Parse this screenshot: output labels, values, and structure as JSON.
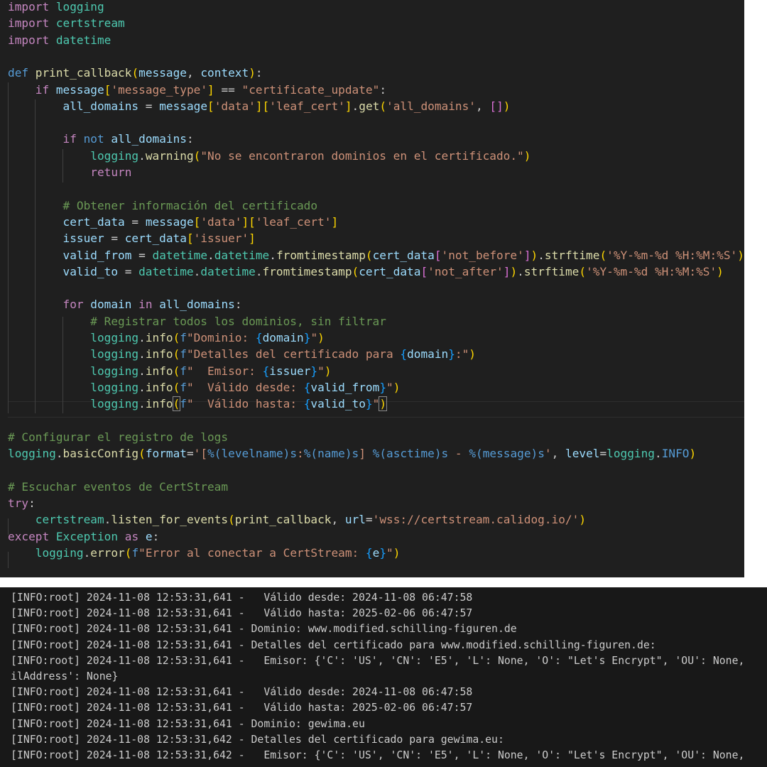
{
  "colors": {
    "editor_bg": "#1f1f1f",
    "terminal_bg": "#181818",
    "keyword": "#c586c0",
    "def_keyword": "#569cd6",
    "function": "#dcdcaa",
    "variable": "#9cdcfe",
    "class": "#4ec9b0",
    "string": "#ce9178",
    "comment": "#6a9955",
    "bracket_level_1": "#ffd700",
    "bracket_level_2": "#da70d6",
    "bracket_level_3": "#179fff"
  },
  "editor": {
    "lines": [
      [
        [
          "kw",
          "import"
        ],
        [
          "pun",
          " "
        ],
        [
          "cls",
          "logging"
        ]
      ],
      [
        [
          "kw",
          "import"
        ],
        [
          "pun",
          " "
        ],
        [
          "cls",
          "certstream"
        ]
      ],
      [
        [
          "kw",
          "import"
        ],
        [
          "pun",
          " "
        ],
        [
          "cls",
          "datetime"
        ]
      ],
      [],
      [
        [
          "def",
          "def"
        ],
        [
          "pun",
          " "
        ],
        [
          "fn",
          "print_callback"
        ],
        [
          "br1",
          "("
        ],
        [
          "var",
          "message"
        ],
        [
          "pun",
          ", "
        ],
        [
          "var",
          "context"
        ],
        [
          "br1",
          ")"
        ],
        [
          "pun",
          ":"
        ]
      ],
      [
        [
          "pun",
          "    "
        ],
        [
          "kw",
          "if"
        ],
        [
          "pun",
          " "
        ],
        [
          "var",
          "message"
        ],
        [
          "br1",
          "["
        ],
        [
          "str",
          "'message_type'"
        ],
        [
          "br1",
          "]"
        ],
        [
          "pun",
          " == "
        ],
        [
          "str",
          "\"certificate_update\""
        ],
        [
          "pun",
          ":"
        ]
      ],
      [
        [
          "pun",
          "        "
        ],
        [
          "var",
          "all_domains"
        ],
        [
          "pun",
          " = "
        ],
        [
          "var",
          "message"
        ],
        [
          "br1",
          "["
        ],
        [
          "str",
          "'data'"
        ],
        [
          "br1",
          "]["
        ],
        [
          "str",
          "'leaf_cert'"
        ],
        [
          "br1",
          "]"
        ],
        [
          "pun",
          "."
        ],
        [
          "fn",
          "get"
        ],
        [
          "br1",
          "("
        ],
        [
          "str",
          "'all_domains'"
        ],
        [
          "pun",
          ", "
        ],
        [
          "br2",
          "[]"
        ],
        [
          "br1",
          ")"
        ]
      ],
      [],
      [
        [
          "pun",
          "        "
        ],
        [
          "kw",
          "if"
        ],
        [
          "pun",
          " "
        ],
        [
          "def",
          "not"
        ],
        [
          "pun",
          " "
        ],
        [
          "var",
          "all_domains"
        ],
        [
          "pun",
          ":"
        ]
      ],
      [
        [
          "pun",
          "            "
        ],
        [
          "cls",
          "logging"
        ],
        [
          "pun",
          "."
        ],
        [
          "fn",
          "warning"
        ],
        [
          "br1",
          "("
        ],
        [
          "str",
          "\"No se encontraron dominios en el certificado.\""
        ],
        [
          "br1",
          ")"
        ]
      ],
      [
        [
          "pun",
          "            "
        ],
        [
          "kw",
          "return"
        ]
      ],
      [],
      [
        [
          "pun",
          "        "
        ],
        [
          "cmt",
          "# Obtener información del certificado"
        ]
      ],
      [
        [
          "pun",
          "        "
        ],
        [
          "var",
          "cert_data"
        ],
        [
          "pun",
          " = "
        ],
        [
          "var",
          "message"
        ],
        [
          "br1",
          "["
        ],
        [
          "str",
          "'data'"
        ],
        [
          "br1",
          "]["
        ],
        [
          "str",
          "'leaf_cert'"
        ],
        [
          "br1",
          "]"
        ]
      ],
      [
        [
          "pun",
          "        "
        ],
        [
          "var",
          "issuer"
        ],
        [
          "pun",
          " = "
        ],
        [
          "var",
          "cert_data"
        ],
        [
          "br1",
          "["
        ],
        [
          "str",
          "'issuer'"
        ],
        [
          "br1",
          "]"
        ]
      ],
      [
        [
          "pun",
          "        "
        ],
        [
          "var",
          "valid_from"
        ],
        [
          "pun",
          " = "
        ],
        [
          "cls",
          "datetime"
        ],
        [
          "pun",
          "."
        ],
        [
          "cls",
          "datetime"
        ],
        [
          "pun",
          "."
        ],
        [
          "fn",
          "fromtimestamp"
        ],
        [
          "br1",
          "("
        ],
        [
          "var",
          "cert_data"
        ],
        [
          "br2",
          "["
        ],
        [
          "str",
          "'not_before'"
        ],
        [
          "br2",
          "]"
        ],
        [
          "br1",
          ")"
        ],
        [
          "pun",
          "."
        ],
        [
          "fn",
          "strftime"
        ],
        [
          "br1",
          "("
        ],
        [
          "str",
          "'%Y-%m-%d %H:%M:%S'"
        ],
        [
          "br1",
          ")"
        ]
      ],
      [
        [
          "pun",
          "        "
        ],
        [
          "var",
          "valid_to"
        ],
        [
          "pun",
          " = "
        ],
        [
          "cls",
          "datetime"
        ],
        [
          "pun",
          "."
        ],
        [
          "cls",
          "datetime"
        ],
        [
          "pun",
          "."
        ],
        [
          "fn",
          "fromtimestamp"
        ],
        [
          "br1",
          "("
        ],
        [
          "var",
          "cert_data"
        ],
        [
          "br2",
          "["
        ],
        [
          "str",
          "'not_after'"
        ],
        [
          "br2",
          "]"
        ],
        [
          "br1",
          ")"
        ],
        [
          "pun",
          "."
        ],
        [
          "fn",
          "strftime"
        ],
        [
          "br1",
          "("
        ],
        [
          "str",
          "'%Y-%m-%d %H:%M:%S'"
        ],
        [
          "br1",
          ")"
        ]
      ],
      [],
      [
        [
          "pun",
          "        "
        ],
        [
          "kw",
          "for"
        ],
        [
          "pun",
          " "
        ],
        [
          "var",
          "domain"
        ],
        [
          "pun",
          " "
        ],
        [
          "kw",
          "in"
        ],
        [
          "pun",
          " "
        ],
        [
          "var",
          "all_domains"
        ],
        [
          "pun",
          ":"
        ]
      ],
      [
        [
          "pun",
          "            "
        ],
        [
          "cmt",
          "# Registrar todos los dominios, sin filtrar"
        ]
      ],
      [
        [
          "pun",
          "            "
        ],
        [
          "cls",
          "logging"
        ],
        [
          "pun",
          "."
        ],
        [
          "fn",
          "info"
        ],
        [
          "br1",
          "("
        ],
        [
          "def",
          "f"
        ],
        [
          "str",
          "\"Dominio: "
        ],
        [
          "br3",
          "{"
        ],
        [
          "var",
          "domain"
        ],
        [
          "br3",
          "}"
        ],
        [
          "str",
          "\""
        ],
        [
          "br1",
          ")"
        ]
      ],
      [
        [
          "pun",
          "            "
        ],
        [
          "cls",
          "logging"
        ],
        [
          "pun",
          "."
        ],
        [
          "fn",
          "info"
        ],
        [
          "br1",
          "("
        ],
        [
          "def",
          "f"
        ],
        [
          "str",
          "\"Detalles del certificado para "
        ],
        [
          "br3",
          "{"
        ],
        [
          "var",
          "domain"
        ],
        [
          "br3",
          "}"
        ],
        [
          "str",
          ":\""
        ],
        [
          "br1",
          ")"
        ]
      ],
      [
        [
          "pun",
          "            "
        ],
        [
          "cls",
          "logging"
        ],
        [
          "pun",
          "."
        ],
        [
          "fn",
          "info"
        ],
        [
          "br1",
          "("
        ],
        [
          "def",
          "f"
        ],
        [
          "str",
          "\"  Emisor: "
        ],
        [
          "br3",
          "{"
        ],
        [
          "var",
          "issuer"
        ],
        [
          "br3",
          "}"
        ],
        [
          "str",
          "\""
        ],
        [
          "br1",
          ")"
        ]
      ],
      [
        [
          "pun",
          "            "
        ],
        [
          "cls",
          "logging"
        ],
        [
          "pun",
          "."
        ],
        [
          "fn",
          "info"
        ],
        [
          "br1",
          "("
        ],
        [
          "def",
          "f"
        ],
        [
          "str",
          "\"  Válido desde: "
        ],
        [
          "br3",
          "{"
        ],
        [
          "var",
          "valid_from"
        ],
        [
          "br3",
          "}"
        ],
        [
          "str",
          "\""
        ],
        [
          "br1",
          ")"
        ]
      ],
      [
        [
          "pun",
          "            "
        ],
        [
          "cls",
          "logging"
        ],
        [
          "pun",
          "."
        ],
        [
          "fn",
          "info"
        ],
        [
          "br1m",
          "("
        ],
        [
          "def",
          "f"
        ],
        [
          "str",
          "\"  Válido hasta: "
        ],
        [
          "br3",
          "{"
        ],
        [
          "var",
          "valid_to"
        ],
        [
          "br3",
          "}"
        ],
        [
          "str",
          "\""
        ],
        [
          "br1m",
          ")"
        ]
      ],
      [],
      [
        [
          "cmt",
          "# Configurar el registro de logs"
        ]
      ],
      [
        [
          "cls",
          "logging"
        ],
        [
          "pun",
          "."
        ],
        [
          "fn",
          "basicConfig"
        ],
        [
          "br1",
          "("
        ],
        [
          "var",
          "format"
        ],
        [
          "pun",
          "="
        ],
        [
          "str",
          "'["
        ],
        [
          "def",
          "%(levelname)s"
        ],
        [
          "str",
          ":"
        ],
        [
          "def",
          "%(name)s"
        ],
        [
          "str",
          "] "
        ],
        [
          "def",
          "%(asctime)s"
        ],
        [
          "str",
          " - "
        ],
        [
          "def",
          "%(message)s"
        ],
        [
          "str",
          "'"
        ],
        [
          "pun",
          ", "
        ],
        [
          "var",
          "level"
        ],
        [
          "pun",
          "="
        ],
        [
          "cls",
          "logging"
        ],
        [
          "pun",
          "."
        ],
        [
          "def",
          "INFO"
        ],
        [
          "br1",
          ")"
        ]
      ],
      [],
      [
        [
          "cmt",
          "# Escuchar eventos de CertStream"
        ]
      ],
      [
        [
          "kw",
          "try"
        ],
        [
          "pun",
          ":"
        ]
      ],
      [
        [
          "pun",
          "    "
        ],
        [
          "cls",
          "certstream"
        ],
        [
          "pun",
          "."
        ],
        [
          "fn",
          "listen_for_events"
        ],
        [
          "br1",
          "("
        ],
        [
          "fn",
          "print_callback"
        ],
        [
          "pun",
          ", "
        ],
        [
          "var",
          "url"
        ],
        [
          "pun",
          "="
        ],
        [
          "str",
          "'wss://certstream.calidog.io/'"
        ],
        [
          "br1",
          ")"
        ]
      ],
      [
        [
          "kw",
          "except"
        ],
        [
          "pun",
          " "
        ],
        [
          "cls",
          "Exception"
        ],
        [
          "pun",
          " "
        ],
        [
          "kw",
          "as"
        ],
        [
          "pun",
          " "
        ],
        [
          "var",
          "e"
        ],
        [
          "pun",
          ":"
        ]
      ],
      [
        [
          "pun",
          "    "
        ],
        [
          "cls",
          "logging"
        ],
        [
          "pun",
          "."
        ],
        [
          "fn",
          "error"
        ],
        [
          "br1",
          "("
        ],
        [
          "def",
          "f"
        ],
        [
          "str",
          "\"Error al conectar a CertStream: "
        ],
        [
          "br3",
          "{"
        ],
        [
          "var",
          "e"
        ],
        [
          "br3",
          "}"
        ],
        [
          "str",
          "\""
        ],
        [
          "br1",
          ")"
        ]
      ]
    ]
  },
  "terminal": {
    "lines": [
      "[INFO:root] 2024-11-08 12:53:31,641 -   Válido desde: 2024-11-08 06:47:58",
      "[INFO:root] 2024-11-08 12:53:31,641 -   Válido hasta: 2025-02-06 06:47:57",
      "[INFO:root] 2024-11-08 12:53:31,641 - Dominio: www.modified.schilling-figuren.de",
      "[INFO:root] 2024-11-08 12:53:31,641 - Detalles del certificado para www.modified.schilling-figuren.de:",
      "[INFO:root] 2024-11-08 12:53:31,641 -   Emisor: {'C': 'US', 'CN': 'E5', 'L': None, 'O': \"Let's Encrypt\", 'OU': None,",
      "ilAddress': None}",
      "[INFO:root] 2024-11-08 12:53:31,641 -   Válido desde: 2024-11-08 06:47:58",
      "[INFO:root] 2024-11-08 12:53:31,641 -   Válido hasta: 2025-02-06 06:47:57",
      "[INFO:root] 2024-11-08 12:53:31,641 - Dominio: gewima.eu",
      "[INFO:root] 2024-11-08 12:53:31,642 - Detalles del certificado para gewima.eu:",
      "[INFO:root] 2024-11-08 12:53:31,642 -   Emisor: {'C': 'US', 'CN': 'E5', 'L': None, 'O': \"Let's Encrypt\", 'OU': None,"
    ]
  }
}
